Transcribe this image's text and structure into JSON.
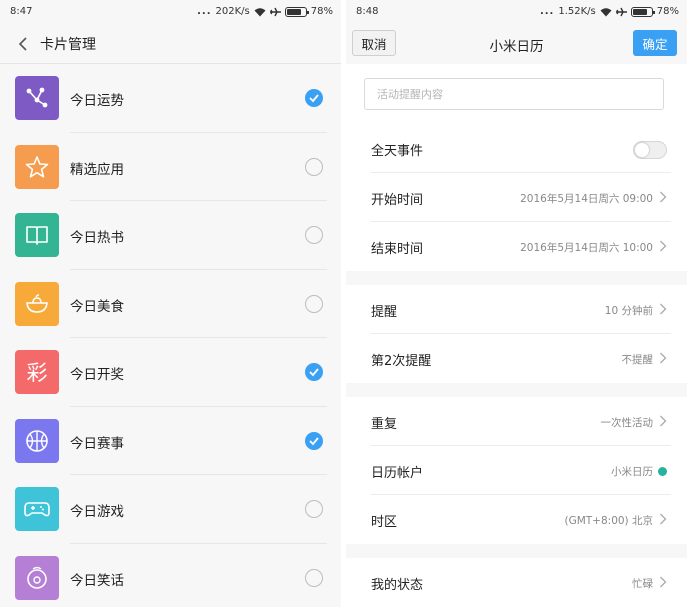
{
  "left": {
    "status": {
      "time": "8:47",
      "dots": "...",
      "speed": "202K/s",
      "battery": "78%",
      "battery_level": 0.78
    },
    "header": {
      "title": "卡片管理"
    },
    "cards": [
      {
        "label": "今日运势",
        "icon": "constellation-icon",
        "color": "#7e5bc4",
        "checked": true
      },
      {
        "label": "精选应用",
        "icon": "star-icon",
        "color": "#f59c4e",
        "checked": false
      },
      {
        "label": "今日热书",
        "icon": "book-icon",
        "color": "#33b594",
        "checked": false
      },
      {
        "label": "今日美食",
        "icon": "bowl-icon",
        "color": "#f7a93a",
        "checked": false
      },
      {
        "label": "今日开奖",
        "icon": "lottery-icon",
        "icon_text": "彩",
        "color": "#f46a6a",
        "checked": true
      },
      {
        "label": "今日赛事",
        "icon": "basketball-icon",
        "color": "#7b77ee",
        "checked": true
      },
      {
        "label": "今日游戏",
        "icon": "gamepad-icon",
        "color": "#3fc3d8",
        "checked": false
      },
      {
        "label": "今日笑话",
        "icon": "smiley-icon",
        "color": "#b67fd6",
        "checked": false
      }
    ]
  },
  "right": {
    "status": {
      "time": "8:48",
      "dots": "...",
      "speed": "1.52K/s",
      "battery": "78%",
      "battery_level": 0.78
    },
    "nav": {
      "cancel": "取消",
      "title": "小米日历",
      "ok": "确定"
    },
    "input": {
      "placeholder": "活动提醒内容",
      "value": ""
    },
    "rows": {
      "allday": {
        "label": "全天事件",
        "toggle_on": false
      },
      "start": {
        "label": "开始时间",
        "value": "2016年5月14日周六 09:00"
      },
      "end": {
        "label": "结束时间",
        "value": "2016年5月14日周六 10:00"
      },
      "reminder": {
        "label": "提醒",
        "value": "10 分钟前"
      },
      "reminder2": {
        "label": "第2次提醒",
        "value": "不提醒"
      },
      "repeat": {
        "label": "重复",
        "value": "一次性活动"
      },
      "account": {
        "label": "日历帐户",
        "value": "小米日历",
        "dot_color": "#24b39c"
      },
      "timezone": {
        "label": "时区",
        "value": "(GMT+8:00) 北京"
      },
      "mystatus": {
        "label": "我的状态",
        "value": "忙碌"
      }
    }
  },
  "colors": {
    "accent": "#3aa0f3",
    "checkbox_on": "#3aa0f3"
  }
}
